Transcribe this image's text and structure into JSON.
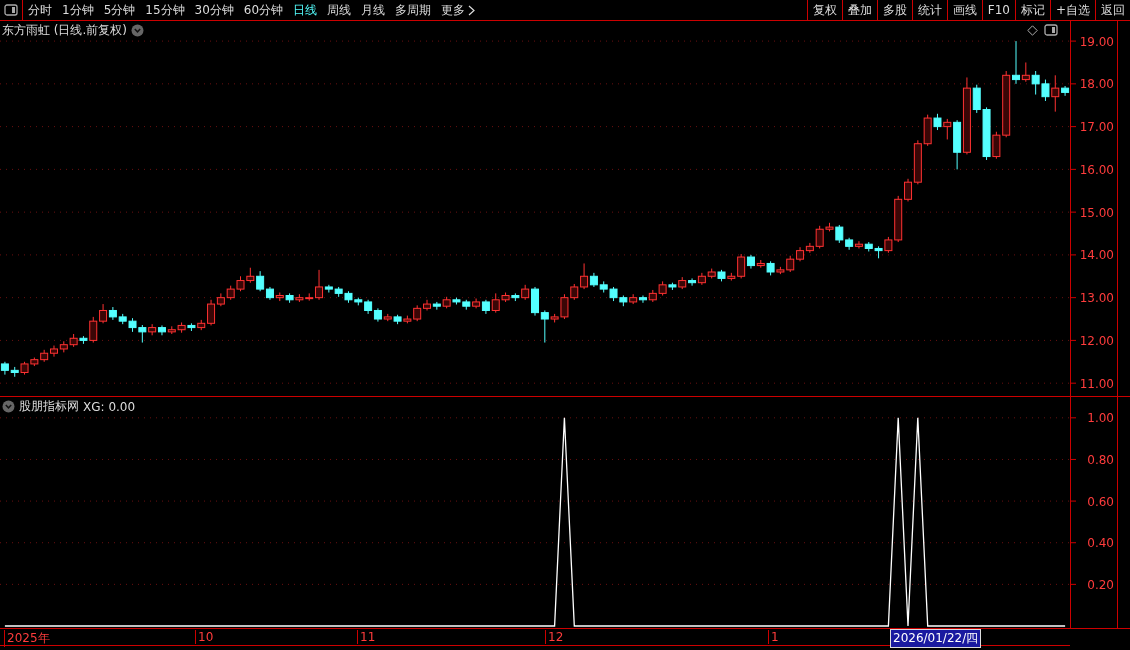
{
  "toolbar": {
    "periods": [
      {
        "label": "分时",
        "selected": false
      },
      {
        "label": "1分钟",
        "selected": false
      },
      {
        "label": "5分钟",
        "selected": false
      },
      {
        "label": "15分钟",
        "selected": false
      },
      {
        "label": "30分钟",
        "selected": false
      },
      {
        "label": "60分钟",
        "selected": false
      },
      {
        "label": "日线",
        "selected": true
      },
      {
        "label": "周线",
        "selected": false
      },
      {
        "label": "月线",
        "selected": false
      },
      {
        "label": "多周期",
        "selected": false
      }
    ],
    "more": "更多",
    "buttons": [
      "复权",
      "叠加",
      "多股",
      "统计",
      "画线",
      "F10",
      "标记",
      "+自选",
      "返回"
    ]
  },
  "main_chart": {
    "title": "东方雨虹 (日线.前复权)",
    "chart_data": {
      "type": "candlestick",
      "grid": true,
      "ylim": [
        10.7,
        19.47
      ],
      "categories": [
        null,
        null,
        null,
        null,
        null,
        null,
        null,
        null,
        null,
        null,
        null,
        null,
        null,
        null,
        null,
        null,
        null,
        null,
        null,
        null,
        null,
        null,
        null,
        null,
        null,
        null,
        null,
        null,
        null,
        null,
        null,
        null,
        null,
        null,
        null,
        null,
        null,
        null,
        null,
        null,
        null,
        null,
        null,
        null,
        null,
        null,
        null,
        null,
        null,
        null,
        null,
        null,
        null,
        null,
        null,
        null,
        null,
        null,
        null,
        null,
        null,
        null,
        null,
        null,
        null,
        null,
        null,
        null,
        null,
        null,
        null,
        null,
        null,
        null,
        null,
        null,
        null,
        null,
        null,
        null,
        null,
        null,
        null,
        null,
        null,
        null,
        null,
        null,
        null,
        null,
        null,
        null,
        null,
        null,
        null,
        null,
        null,
        null,
        null,
        null,
        null,
        null,
        null,
        null,
        null,
        null,
        null,
        null,
        null
      ],
      "yticks": [
        {
          "value": 19,
          "label": "19.00"
        },
        {
          "value": 18,
          "label": "18.00"
        },
        {
          "value": 17,
          "label": "17.00"
        },
        {
          "value": 16,
          "label": "16.00"
        },
        {
          "value": 15,
          "label": "15.00"
        },
        {
          "value": 14,
          "label": "14.00"
        },
        {
          "value": 13,
          "label": "13.00"
        },
        {
          "value": 12,
          "label": "12.00"
        },
        {
          "value": 11,
          "label": "11.00"
        }
      ],
      "ohlc": [
        [
          11.45,
          11.5,
          11.2,
          11.3
        ],
        [
          11.3,
          11.38,
          11.15,
          11.25
        ],
        [
          11.25,
          11.5,
          11.2,
          11.45
        ],
        [
          11.45,
          11.6,
          11.4,
          11.55
        ],
        [
          11.55,
          11.78,
          11.5,
          11.7
        ],
        [
          11.7,
          11.88,
          11.62,
          11.8
        ],
        [
          11.8,
          11.98,
          11.72,
          11.9
        ],
        [
          11.9,
          12.15,
          11.85,
          12.05
        ],
        [
          12.05,
          12.1,
          11.92,
          12.0
        ],
        [
          12.0,
          12.55,
          11.95,
          12.45
        ],
        [
          12.45,
          12.85,
          12.4,
          12.7
        ],
        [
          12.7,
          12.78,
          12.48,
          12.55
        ],
        [
          12.55,
          12.62,
          12.38,
          12.45
        ],
        [
          12.45,
          12.52,
          12.2,
          12.3
        ],
        [
          12.3,
          12.36,
          11.95,
          12.2
        ],
        [
          12.2,
          12.38,
          12.12,
          12.3
        ],
        [
          12.3,
          12.35,
          12.12,
          12.2
        ],
        [
          12.2,
          12.33,
          12.15,
          12.25
        ],
        [
          12.25,
          12.42,
          12.18,
          12.35
        ],
        [
          12.35,
          12.4,
          12.22,
          12.3
        ],
        [
          12.3,
          12.48,
          12.24,
          12.4
        ],
        [
          12.4,
          12.95,
          12.35,
          12.85
        ],
        [
          12.85,
          13.1,
          12.8,
          13.0
        ],
        [
          13.0,
          13.28,
          12.95,
          13.2
        ],
        [
          13.2,
          13.5,
          13.15,
          13.4
        ],
        [
          13.4,
          13.7,
          13.35,
          13.5
        ],
        [
          13.5,
          13.62,
          13.15,
          13.2
        ],
        [
          13.2,
          13.25,
          12.95,
          13.0
        ],
        [
          13.0,
          13.12,
          12.92,
          13.05
        ],
        [
          13.05,
          13.1,
          12.88,
          12.95
        ],
        [
          12.95,
          13.08,
          12.9,
          13.0
        ],
        [
          13.0,
          13.1,
          12.93,
          13.0
        ],
        [
          13.0,
          13.65,
          12.95,
          13.25
        ],
        [
          13.25,
          13.3,
          13.12,
          13.2
        ],
        [
          13.2,
          13.25,
          13.02,
          13.1
        ],
        [
          13.1,
          13.15,
          12.88,
          12.95
        ],
        [
          12.95,
          13.0,
          12.82,
          12.9
        ],
        [
          12.9,
          12.95,
          12.62,
          12.7
        ],
        [
          12.7,
          12.75,
          12.44,
          12.5
        ],
        [
          12.5,
          12.62,
          12.45,
          12.55
        ],
        [
          12.55,
          12.6,
          12.38,
          12.45
        ],
        [
          12.45,
          12.58,
          12.4,
          12.5
        ],
        [
          12.5,
          12.82,
          12.45,
          12.75
        ],
        [
          12.75,
          12.95,
          12.7,
          12.85
        ],
        [
          12.85,
          12.9,
          12.72,
          12.8
        ],
        [
          12.8,
          13.02,
          12.75,
          12.95
        ],
        [
          12.95,
          13.0,
          12.84,
          12.9
        ],
        [
          12.9,
          12.95,
          12.72,
          12.8
        ],
        [
          12.8,
          12.98,
          12.75,
          12.9
        ],
        [
          12.9,
          12.95,
          12.62,
          12.7
        ],
        [
          12.7,
          13.1,
          12.65,
          12.95
        ],
        [
          12.95,
          13.12,
          12.9,
          13.05
        ],
        [
          13.05,
          13.1,
          12.92,
          13.0
        ],
        [
          13.0,
          13.3,
          12.95,
          13.2
        ],
        [
          13.2,
          13.25,
          12.58,
          12.65
        ],
        [
          12.65,
          12.7,
          11.95,
          12.5
        ],
        [
          12.5,
          12.62,
          12.42,
          12.55
        ],
        [
          12.55,
          13.08,
          12.5,
          13.0
        ],
        [
          13.0,
          13.32,
          12.95,
          13.25
        ],
        [
          13.25,
          13.8,
          13.2,
          13.5
        ],
        [
          13.5,
          13.58,
          13.25,
          13.3
        ],
        [
          13.3,
          13.38,
          13.12,
          13.2
        ],
        [
          13.2,
          13.25,
          12.92,
          13.0
        ],
        [
          13.0,
          13.05,
          12.8,
          12.9
        ],
        [
          12.9,
          13.08,
          12.85,
          13.0
        ],
        [
          13.0,
          13.05,
          12.88,
          12.95
        ],
        [
          12.95,
          13.18,
          12.9,
          13.1
        ],
        [
          13.1,
          13.38,
          13.05,
          13.3
        ],
        [
          13.3,
          13.35,
          13.18,
          13.25
        ],
        [
          13.25,
          13.48,
          13.2,
          13.4
        ],
        [
          13.4,
          13.45,
          13.28,
          13.35
        ],
        [
          13.35,
          13.58,
          13.3,
          13.5
        ],
        [
          13.5,
          13.68,
          13.45,
          13.6
        ],
        [
          13.6,
          13.65,
          13.38,
          13.45
        ],
        [
          13.45,
          13.58,
          13.4,
          13.5
        ],
        [
          13.5,
          14.02,
          13.45,
          13.95
        ],
        [
          13.95,
          14.0,
          13.68,
          13.75
        ],
        [
          13.75,
          13.88,
          13.7,
          13.8
        ],
        [
          13.8,
          13.85,
          13.52,
          13.6
        ],
        [
          13.6,
          13.72,
          13.55,
          13.65
        ],
        [
          13.65,
          13.98,
          13.6,
          13.9
        ],
        [
          13.9,
          14.18,
          13.85,
          14.1
        ],
        [
          14.1,
          14.28,
          14.05,
          14.2
        ],
        [
          14.2,
          14.68,
          14.15,
          14.6
        ],
        [
          14.6,
          14.75,
          14.55,
          14.65
        ],
        [
          14.65,
          14.7,
          14.28,
          14.35
        ],
        [
          14.35,
          14.4,
          14.12,
          14.2
        ],
        [
          14.2,
          14.32,
          14.15,
          14.25
        ],
        [
          14.25,
          14.3,
          14.08,
          14.15
        ],
        [
          14.15,
          14.2,
          13.92,
          14.1
        ],
        [
          14.1,
          14.42,
          14.05,
          14.35
        ],
        [
          14.35,
          15.38,
          14.3,
          15.3
        ],
        [
          15.3,
          15.78,
          15.25,
          15.7
        ],
        [
          15.7,
          16.68,
          15.65,
          16.6
        ],
        [
          16.6,
          17.28,
          16.55,
          17.2
        ],
        [
          17.2,
          17.3,
          16.92,
          17.0
        ],
        [
          17.0,
          17.18,
          16.7,
          17.1
        ],
        [
          17.1,
          17.15,
          16.0,
          16.4
        ],
        [
          16.4,
          18.15,
          16.35,
          17.9
        ],
        [
          17.9,
          17.98,
          17.32,
          17.4
        ],
        [
          17.4,
          17.45,
          16.22,
          16.3
        ],
        [
          16.3,
          16.88,
          16.25,
          16.8
        ],
        [
          16.8,
          18.3,
          16.75,
          18.2
        ],
        [
          18.2,
          19.0,
          18.0,
          18.1
        ],
        [
          18.1,
          18.5,
          18.05,
          18.2
        ],
        [
          18.2,
          18.3,
          17.75,
          18.0
        ],
        [
          18.0,
          18.1,
          17.6,
          17.7
        ],
        [
          17.7,
          18.2,
          17.35,
          17.9
        ],
        [
          17.9,
          17.95,
          17.72,
          17.8
        ]
      ]
    }
  },
  "indicator": {
    "title": "股朋指标网",
    "reading": "XG: 0.00",
    "chart_data": {
      "type": "line",
      "grid": true,
      "ylim": [
        0,
        1.1
      ],
      "categories": [
        null,
        null,
        null,
        null,
        null,
        null,
        null,
        null,
        null,
        null,
        null,
        null,
        null,
        null,
        null,
        null,
        null,
        null,
        null,
        null,
        null,
        null,
        null,
        null,
        null,
        null,
        null,
        null,
        null,
        null,
        null,
        null,
        null,
        null,
        null,
        null,
        null,
        null,
        null,
        null,
        null,
        null,
        null,
        null,
        null,
        null,
        null,
        null,
        null,
        null,
        null,
        null,
        null,
        null,
        null,
        null,
        null,
        null,
        null,
        null,
        null,
        null,
        null,
        null,
        null,
        null,
        null,
        null,
        null,
        null,
        null,
        null,
        null,
        null,
        null,
        null,
        null,
        null,
        null,
        null,
        null,
        null,
        null,
        null,
        null,
        null,
        null,
        null,
        null,
        null,
        null,
        null,
        null,
        null,
        null,
        null,
        null,
        null,
        null,
        null,
        null,
        null,
        null,
        null,
        null,
        null,
        null,
        null,
        null
      ],
      "yticks": [
        {
          "value": 1,
          "label": "1.00"
        },
        {
          "value": 0.8,
          "label": "0.80"
        },
        {
          "value": 0.6,
          "label": "0.60"
        },
        {
          "value": 0.4,
          "label": "0.40"
        },
        {
          "value": 0.2,
          "label": "0.20"
        }
      ],
      "series": [
        {
          "color": "#ffffff",
          "values": [
            0,
            0,
            0,
            0,
            0,
            0,
            0,
            0,
            0,
            0,
            0,
            0,
            0,
            0,
            0,
            0,
            0,
            0,
            0,
            0,
            0,
            0,
            0,
            0,
            0,
            0,
            0,
            0,
            0,
            0,
            0,
            0,
            0,
            0,
            0,
            0,
            0,
            0,
            0,
            0,
            0,
            0,
            0,
            0,
            0,
            0,
            0,
            0,
            0,
            0,
            0,
            0,
            0,
            0,
            0,
            0,
            0,
            1,
            0,
            0,
            0,
            0,
            0,
            0,
            0,
            0,
            0,
            0,
            0,
            0,
            0,
            0,
            0,
            0,
            0,
            0,
            0,
            0,
            0,
            0,
            0,
            0,
            0,
            0,
            0,
            0,
            0,
            0,
            0,
            0,
            0,
            1,
            0,
            1,
            0,
            0,
            0,
            0,
            0,
            0,
            0,
            0,
            0,
            0,
            0,
            0,
            0,
            0,
            0
          ]
        }
      ]
    }
  },
  "time_axis": {
    "labels": [
      "2025年",
      "10",
      "11",
      "12",
      "1"
    ],
    "cursor_date": "2026/01/22/四"
  }
}
